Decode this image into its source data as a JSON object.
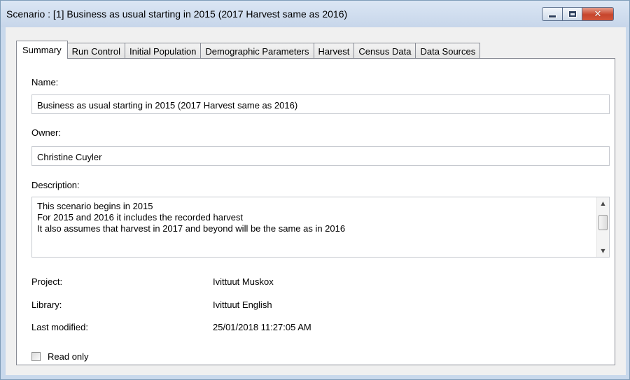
{
  "window": {
    "title": "Scenario : [1] Business as usual starting in 2015 (2017 Harvest same as 2016)",
    "close_glyph": "✕"
  },
  "tabs": [
    {
      "label": "Summary"
    },
    {
      "label": "Run Control"
    },
    {
      "label": "Initial Population"
    },
    {
      "label": "Demographic Parameters"
    },
    {
      "label": "Harvest"
    },
    {
      "label": "Census Data"
    },
    {
      "label": "Data Sources"
    }
  ],
  "summary": {
    "name_label": "Name:",
    "name_value": "Business as usual starting in 2015 (2017 Harvest same as 2016)",
    "owner_label": "Owner:",
    "owner_value": "Christine Cuyler",
    "description_label": "Description:",
    "description_value": "This scenario begins in 2015\nFor 2015 and 2016 it includes the recorded harvest\nIt also assumes that harvest in 2017 and beyond will be the same as in 2016",
    "project_label": "Project:",
    "project_value": "Ivittuut Muskox",
    "library_label": "Library:",
    "library_value": "Ivittuut English",
    "last_modified_label": "Last modified:",
    "last_modified_value": "25/01/2018 11:27:05 AM",
    "read_only_label": "Read only",
    "read_only_checked": false
  }
}
